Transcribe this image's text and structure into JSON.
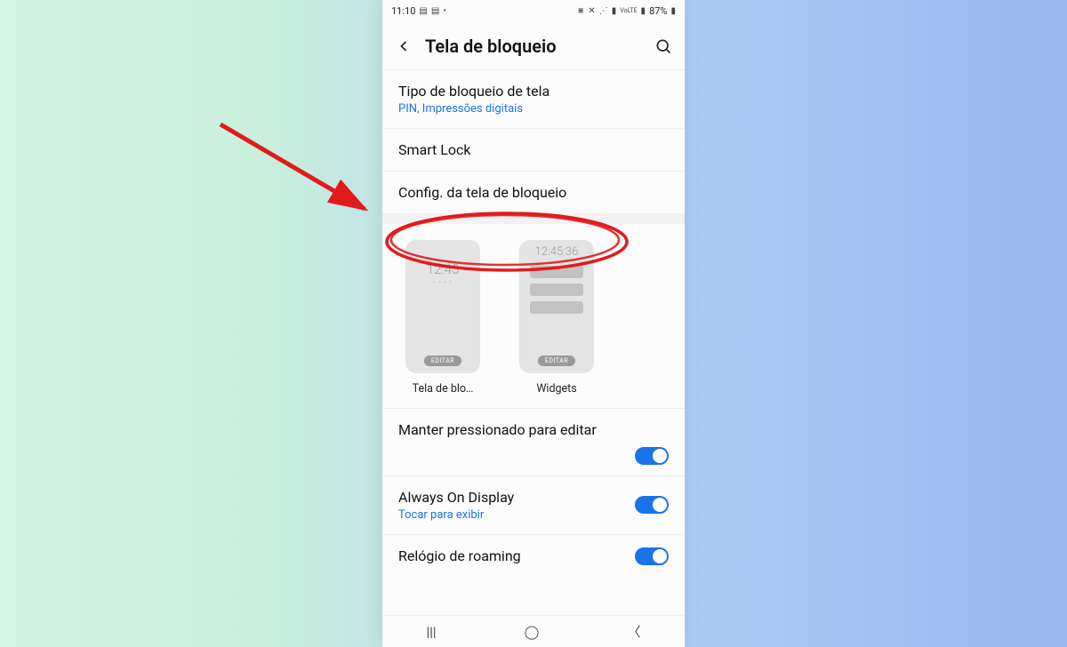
{
  "statusbar": {
    "time": "11:10",
    "battery": "87%"
  },
  "header": {
    "title": "Tela de bloqueio"
  },
  "rows": {
    "lock_type": {
      "title": "Tipo de bloqueio de tela",
      "sub": "PIN, Impressões digitais"
    },
    "smart_lock": {
      "title": "Smart Lock"
    },
    "config": {
      "title": "Config. da tela de bloqueio"
    }
  },
  "previews": {
    "a": {
      "clock": "12:45",
      "dots": "• • • •",
      "badge": "EDITAR",
      "label": "Tela de blo…"
    },
    "b": {
      "clock": "12:45:36",
      "badge": "EDITAR",
      "label": "Widgets"
    }
  },
  "toggles": {
    "hold_edit": {
      "title": "Manter pressionado para editar"
    },
    "aod": {
      "title": "Always On Display",
      "sub": "Tocar para exibir"
    },
    "roaming": {
      "title": "Relógio de roaming"
    }
  },
  "colors": {
    "accent": "#1a73e8",
    "annotation": "#e11b1b"
  }
}
